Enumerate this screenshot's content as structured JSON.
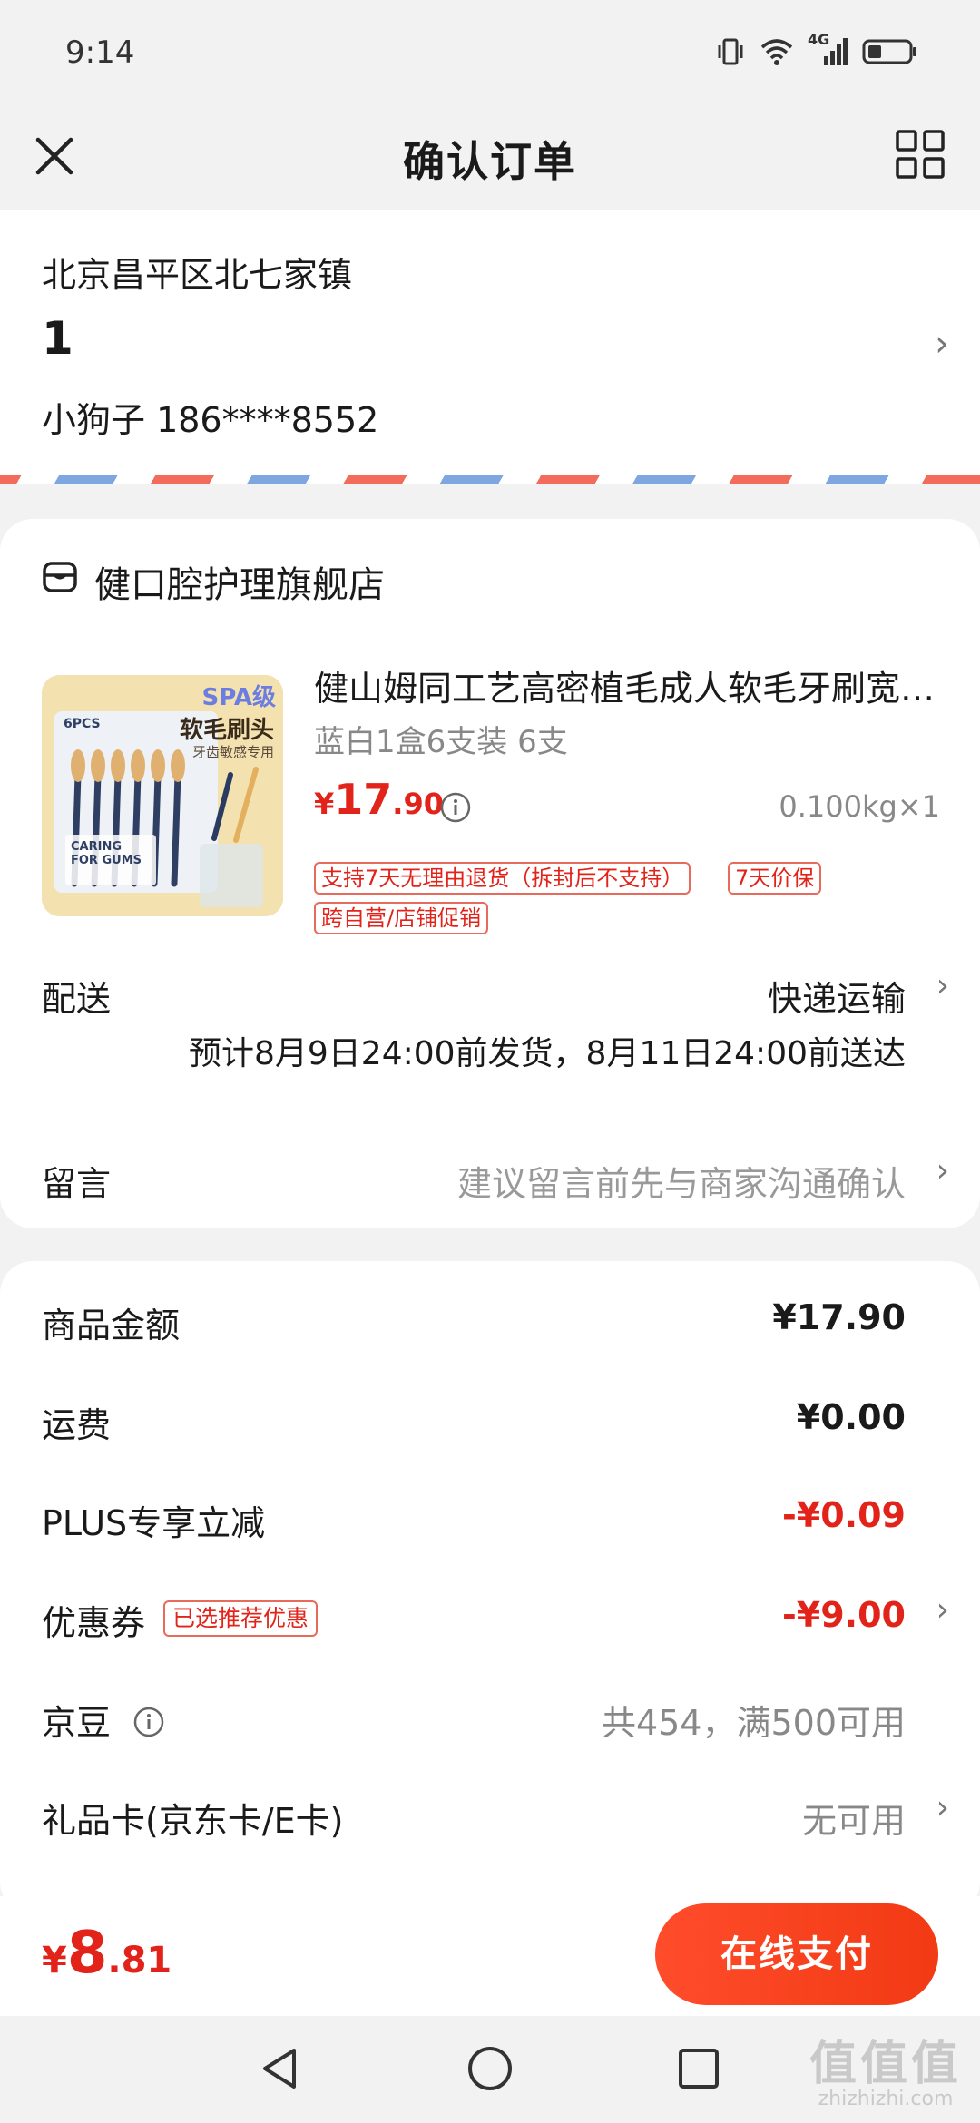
{
  "status_bar": {
    "time": "9:14",
    "network": "4G"
  },
  "nav": {
    "title": "确认订单",
    "close_icon": "close-icon",
    "menu_icon": "grid-menu-icon"
  },
  "address": {
    "region": "北京昌平区北七家镇",
    "detail": "1",
    "contact": "小狗子 186****8552"
  },
  "shop": {
    "name": "健口腔护理旗舰店",
    "product": {
      "image": {
        "brand_badge": "SPA级",
        "pcs": "6PCS",
        "headline": "软毛刷头",
        "subline": "牙齿敏感专用",
        "card_text": "CARING FOR GUMS"
      },
      "title": "健山姆同工艺高密植毛成人软毛牙刷宽头家庭装",
      "spec": "蓝白1盒6支装 6支",
      "price_currency": "¥",
      "price_int": "17",
      "price_dec": ".90",
      "weight_qty": "0.100kg×1",
      "tags": [
        "支持7天无理由退货（拆封后不支持）",
        "7天价保",
        "跨自营/店铺促销"
      ]
    },
    "delivery": {
      "label": "配送",
      "method": "快递运输",
      "estimate": "预计8月9日24:00前发货，8月11日24:00前送达"
    },
    "message": {
      "label": "留言",
      "placeholder": "建议留言前先与商家沟通确认"
    }
  },
  "costs": {
    "goods_label": "商品金额",
    "goods_value": "¥17.90",
    "shipping_label": "运费",
    "shipping_value": "¥0.00",
    "plus_label": "PLUS专享立减",
    "plus_value": "-¥0.09",
    "coupon_label": "优惠券",
    "coupon_badge": "已选推荐优惠",
    "coupon_value": "-¥9.00",
    "jingdou_label": "京豆",
    "jingdou_value": "共454，满500可用",
    "giftcard_label": "礼品卡(京东卡/E卡)",
    "giftcard_value": "无可用"
  },
  "bottom": {
    "total_currency": "¥",
    "total_int": "8",
    "total_dec": ".81",
    "pay_label": "在线支付"
  },
  "watermark": {
    "main": "值值值",
    "sub": "zhizhizhi.com"
  },
  "colors": {
    "accent": "#e2231a",
    "pay_button": "#f23a14",
    "background": "#f2f2f2"
  }
}
